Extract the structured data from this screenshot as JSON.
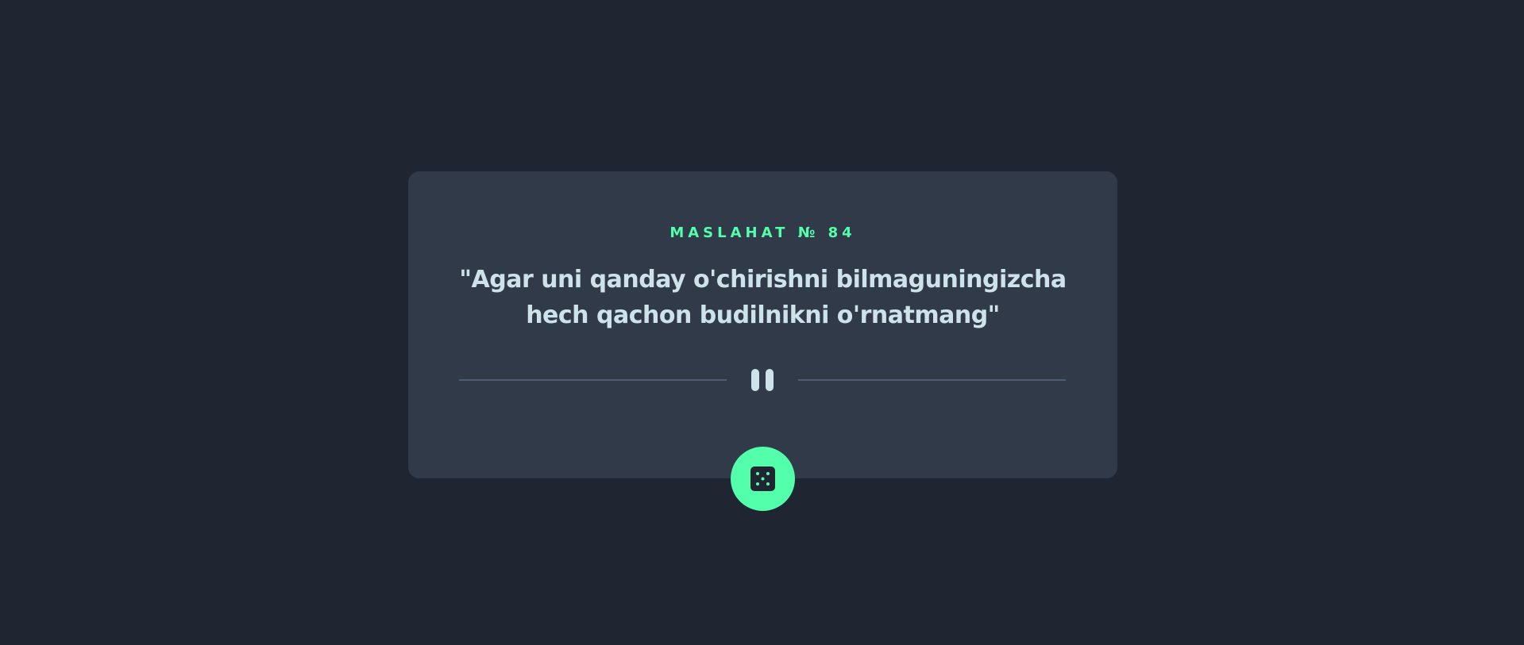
{
  "advice": {
    "label": "MASLAHAT № 84",
    "quote": "\"Agar uni qanday o'chirishni bilmaguningizcha hech qachon budilnikni o'rnatmang\""
  },
  "icons": {
    "divider": "pause-icon",
    "button": "dice-icon"
  },
  "colors": {
    "background": "#1f2632",
    "card": "#313a48",
    "accent": "#53ffaa",
    "text": "#cee3e9",
    "divider": "#4e5d73"
  }
}
